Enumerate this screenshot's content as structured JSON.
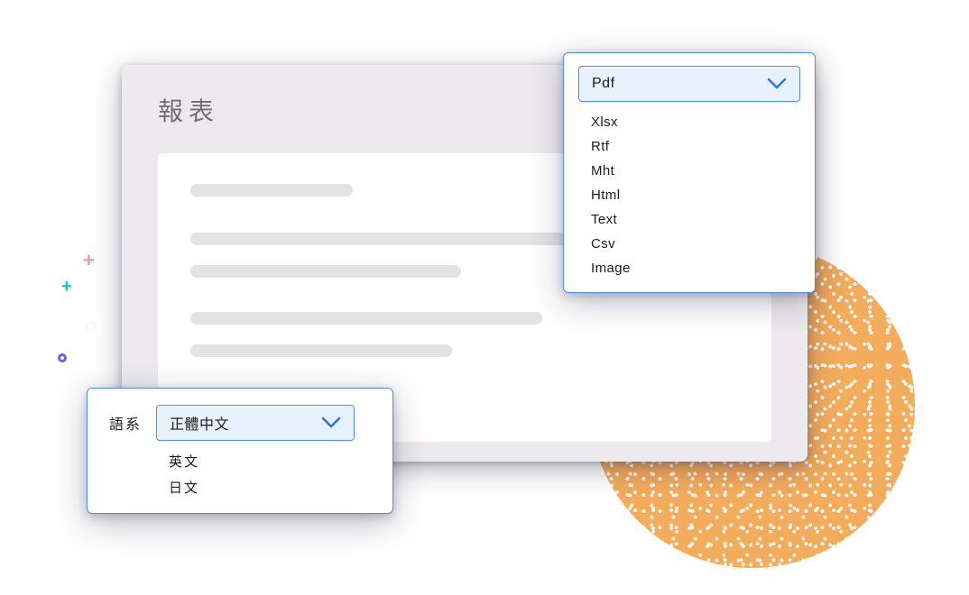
{
  "window": {
    "title": "報表"
  },
  "format_dropdown": {
    "selected": "Pdf",
    "options": [
      "Xlsx",
      "Rtf",
      "Mht",
      "Html",
      "Text",
      "Csv",
      "Image"
    ]
  },
  "language_dropdown": {
    "label": "語系",
    "selected": "正體中文",
    "options": [
      "英文",
      "日文"
    ]
  }
}
